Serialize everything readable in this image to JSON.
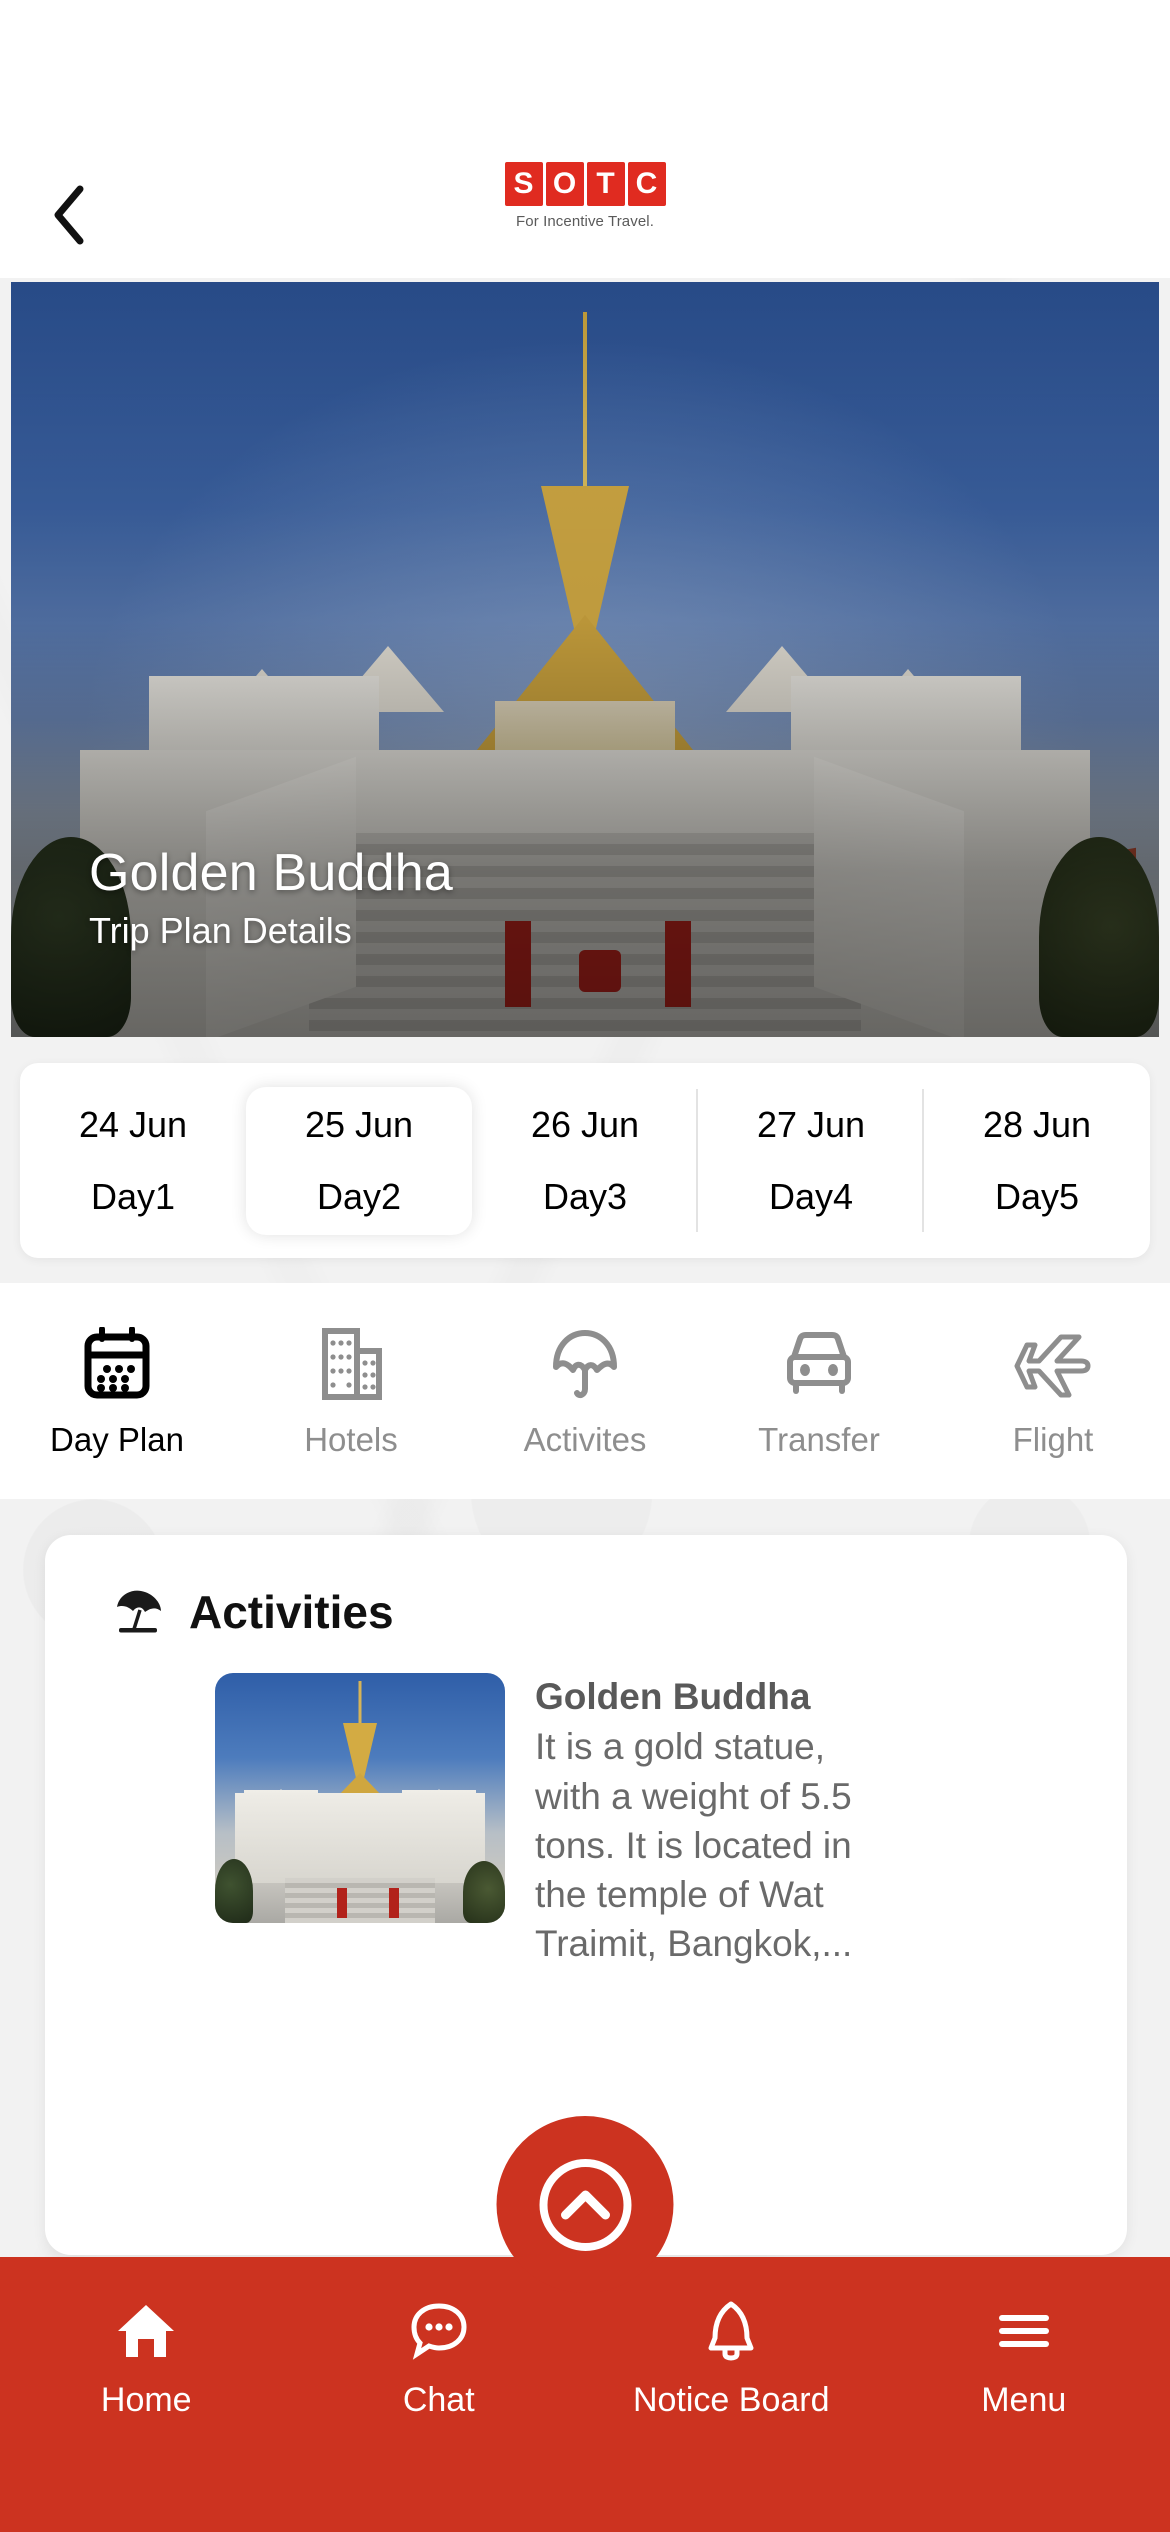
{
  "brand": {
    "accent_red": "#cc3320",
    "logo_red": "#e02b20",
    "logo_letters": [
      "S",
      "O",
      "T",
      "C"
    ],
    "logo_tagline": "For Incentive Travel.",
    "back_icon": "chevron-left-icon"
  },
  "hero": {
    "title": "Golden Buddha",
    "subtitle": "Trip Plan Details"
  },
  "days": {
    "selected_index": 1,
    "items": [
      {
        "date": "24 Jun",
        "day": "Day1"
      },
      {
        "date": "25 Jun",
        "day": "Day2"
      },
      {
        "date": "26 Jun",
        "day": "Day3"
      },
      {
        "date": "27 Jun",
        "day": "Day4"
      },
      {
        "date": "28 Jun",
        "day": "Day5"
      }
    ]
  },
  "tabs": {
    "active_index": 0,
    "items": [
      {
        "label": "Day Plan",
        "icon": "calendar-icon"
      },
      {
        "label": "Hotels",
        "icon": "buildings-icon"
      },
      {
        "label": "Activites",
        "icon": "umbrella-icon"
      },
      {
        "label": "Transfer",
        "icon": "car-icon"
      },
      {
        "label": "Flight",
        "icon": "airplane-icon"
      }
    ]
  },
  "activities": {
    "section_title": "Activities",
    "section_icon": "beach-umbrella-icon",
    "entry": {
      "name": "Golden Buddha",
      "description": "It is a gold statue, with a weight of 5.5 tons. It is located in the temple of Wat Traimit, Bangkok,...",
      "thumbnail_alt": "golden-buddha-temple-photo"
    }
  },
  "fab": {
    "icon": "chevron-up-circle-icon"
  },
  "bottom_nav": {
    "items": [
      {
        "label": "Home",
        "icon": "home-icon"
      },
      {
        "label": "Chat",
        "icon": "chat-bubble-icon"
      },
      {
        "label": "Notice Board",
        "icon": "bell-icon"
      },
      {
        "label": "Menu",
        "icon": "hamburger-menu-icon"
      }
    ]
  }
}
